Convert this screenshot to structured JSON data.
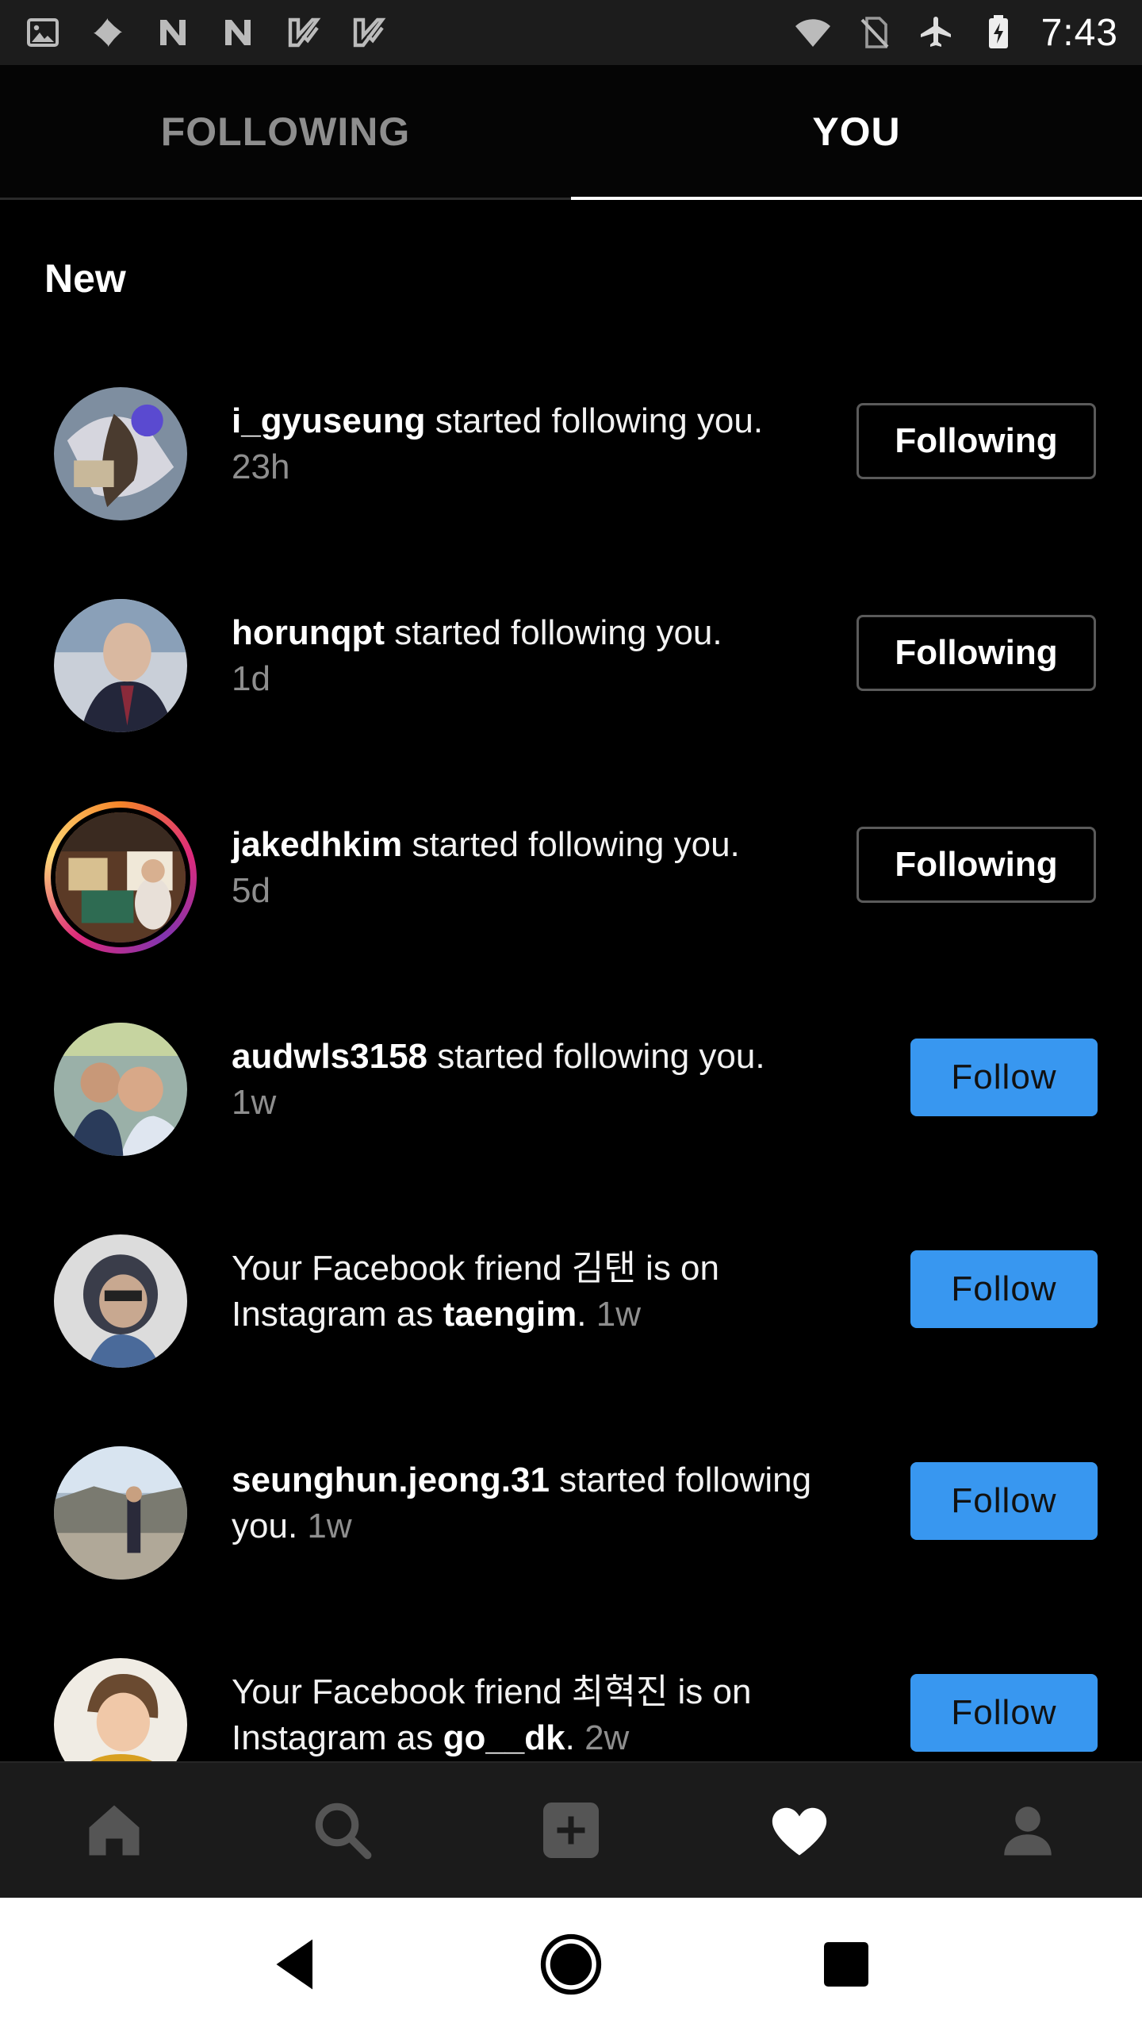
{
  "status_bar": {
    "time": "7:43",
    "left_icons": [
      "image-icon",
      "pinwheel-icon",
      "n-logo-icon",
      "n-logo-icon",
      "check-badge-icon",
      "check-badge-icon"
    ],
    "right_icons": [
      "wifi-icon",
      "no-sim-icon",
      "airplane-icon",
      "battery-charging-icon"
    ]
  },
  "tabs": [
    {
      "label": "FOLLOWING",
      "active": false
    },
    {
      "label": "YOU",
      "active": true
    }
  ],
  "section_title": "New",
  "notifications": [
    {
      "user": "i_gyuseung",
      "text": " started following you.",
      "time": "23h",
      "button": "Following"
    },
    {
      "user": "horunqpt",
      "text": " started following you.",
      "time": "1d",
      "button": "Following"
    },
    {
      "user": "jakedhkim",
      "text": " started following you.",
      "time": "5d",
      "button": "Following"
    },
    {
      "user": "audwls3158",
      "text": " started following you.",
      "time": "1w",
      "button": "Follow"
    },
    {
      "prefix": "Your Facebook friend 김탠 is on Instagram as ",
      "user": "taengim",
      "suffix": ". ",
      "time": "1w",
      "button": "Follow"
    },
    {
      "user": "seunghun.jeong.31",
      "text": " started following you. ",
      "time": "1w",
      "button": "Follow"
    },
    {
      "prefix": "Your Facebook friend 최혁진 is on Instagram as ",
      "user": "go__dk",
      "suffix": ". ",
      "time": "2w",
      "button": "Follow"
    }
  ],
  "bottom_nav": [
    "home-icon",
    "search-icon",
    "add-post-icon",
    "heart-icon",
    "profile-icon"
  ],
  "system_nav": [
    "back-icon",
    "home-circle-icon",
    "recents-icon"
  ],
  "colors": {
    "follow_button": "#3897f0",
    "muted_text": "#8e8e8e",
    "background": "#000000"
  }
}
